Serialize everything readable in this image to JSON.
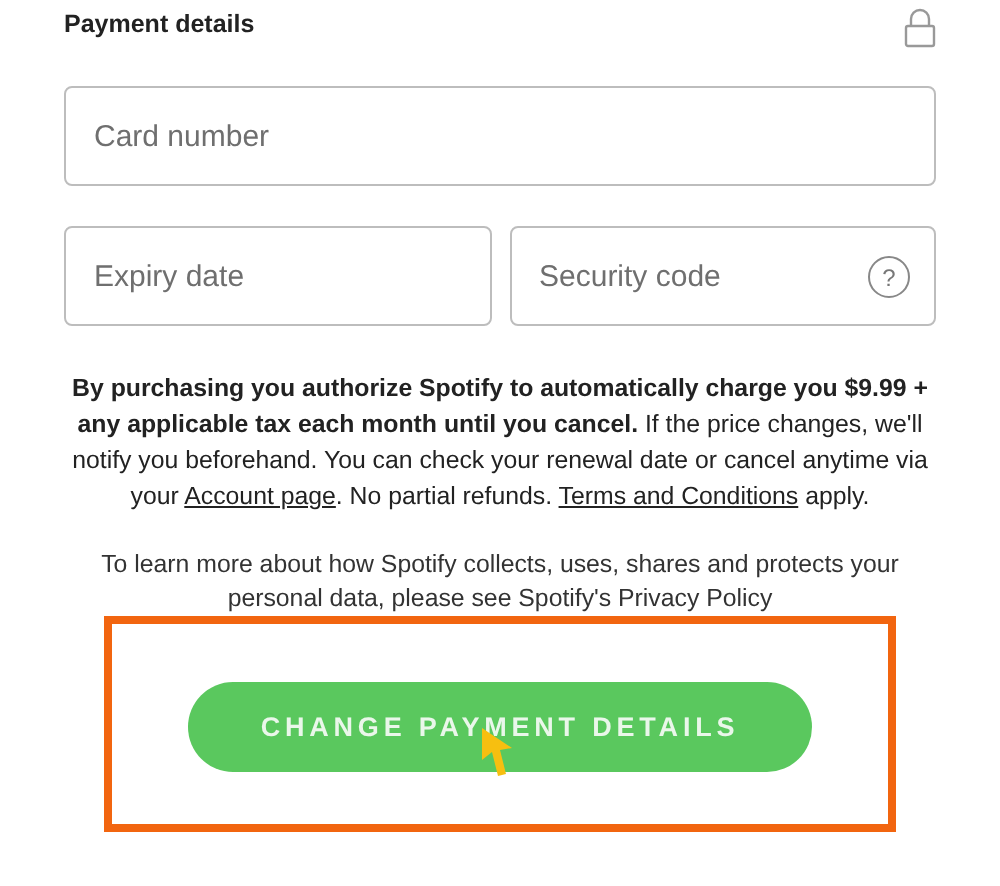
{
  "section_title": "Payment details",
  "fields": [
    {
      "placeholder": "Card number"
    },
    {
      "placeholder": "Expiry date"
    },
    {
      "placeholder": "Security code",
      "help": "?"
    }
  ],
  "legal": [
    {
      "kind": "text",
      "text": "**By purchasing you authorize Spotify to automatically charge you $9.99 + any applicable tax each month until you cancel.** If the price changes, we'll notify you beforehand. You can check your renewal date or cancel anytime via your "
    },
    {
      "kind": "link",
      "text": "Account page"
    },
    {
      "kind": "text",
      "text": ". No partial refunds. "
    },
    {
      "kind": "link",
      "text": "Terms and Conditions"
    },
    {
      "kind": "text",
      "text": " apply."
    }
  ],
  "privacy": "To learn more about how Spotify collects, uses, shares and protects your personal data, please see Spotify's Privacy Policy",
  "button": "CHANGE PAYMENT DETAILS"
}
